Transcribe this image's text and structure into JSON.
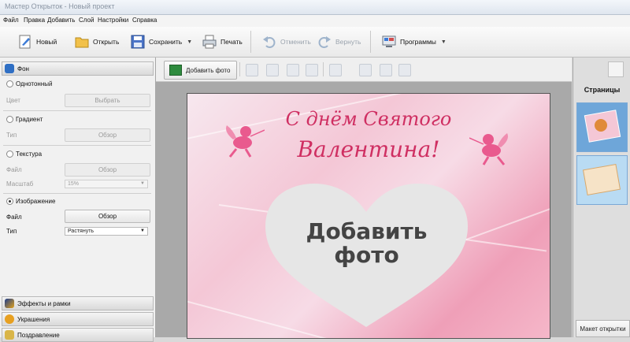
{
  "window": {
    "title": "Мастер Открыток - Новый проект"
  },
  "menu": [
    "Файл",
    "Правка",
    "Добавить",
    "Слой",
    "Настройки",
    "Справка"
  ],
  "toolbar": {
    "new": "Новый",
    "open": "Открыть",
    "save": "Сохранить",
    "print": "Печать",
    "undo": "Отменить",
    "redo": "Вернуть",
    "programs": "Программы"
  },
  "left_panel": {
    "background_section": "Фон",
    "solid": {
      "label": "Однотонный",
      "color_label": "Цвет",
      "button": "Выбрать"
    },
    "gradient": {
      "label": "Градиент",
      "type_label": "Тип",
      "button": "Обзор"
    },
    "texture": {
      "label": "Текстура",
      "file_label": "Файл",
      "button": "Обзор",
      "scale_label": "Масштаб",
      "scale_value": "15%"
    },
    "image": {
      "label": "Изображение",
      "file_label": "Файл",
      "button": "Обзор",
      "type_label": "Тип",
      "type_value": "Растянуть"
    },
    "effects_section": "Эффекты и рамки",
    "decorations_section": "Украшения",
    "greeting_section": "Поздравление"
  },
  "canvas": {
    "add_photo_button": "Добавить фото",
    "card_line1": "С днём Святого",
    "card_line2": "Валентина!",
    "heart_text_line1": "Добавить",
    "heart_text_line2": "фото"
  },
  "right_panel": {
    "title": "Страницы",
    "layout_button": "Макет открытки"
  },
  "colors": {
    "accent_pink": "#cf2f62",
    "heart_fill": "#e6e6e6",
    "thumb_selected": "#6ea6d9"
  }
}
